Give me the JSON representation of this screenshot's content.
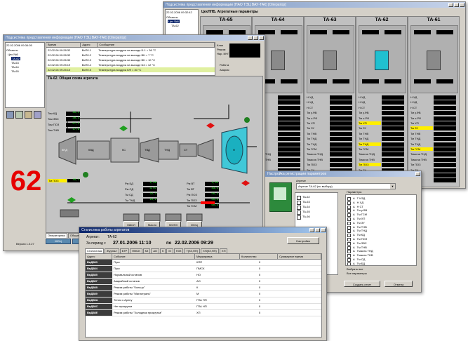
{
  "win_units": {
    "title": "Подсистема представления информации (ПАО ТЭЦ ВАУ-ТАК) [Оператор]",
    "datetime": "22.02.2006 09:32:42",
    "heading": "ЦехЛПБ. Агрегатные параметры",
    "tree_header": "Объекты",
    "tree_items": [
      "Цех №5",
      "ТА-62"
    ],
    "units": [
      "ТА-65",
      "ТА-64",
      "ТА-63",
      "ТА-62",
      "ТА-61"
    ],
    "param_labels": [
      "Н ХД",
      "Н ХД",
      "Н СТ",
      "Тм у.ФВ",
      "Тм о.РФ",
      "Тм ХП",
      "Тм ЗУ",
      "Тм ТНВ",
      "Тм ТНД",
      "Тм ТНД",
      "Тм ГСМ",
      "Тмасла ТНД",
      "Тмасла ТНВ",
      "Тм ПОЗ",
      "Тм ЗУ",
      "Тм КД",
      "Тм ГСМ"
    ]
  },
  "win_scheme": {
    "title": "Подсистема представления информации (ПАО ТЭЦ ВАУ-ТАК) [Оператор]",
    "datetime": "22.02.2006 09:34:05",
    "tree_header": "Объекты",
    "tree_items": [
      "Цех №5",
      "ТА-62",
      "ТА-63",
      "ТА-64",
      "ТА-65"
    ],
    "event_cols": [
      "Время",
      "Адрес",
      "Сообщение"
    ],
    "events": [
      {
        "time": "22.02.06 09:28:32",
        "addr": "ВсП0.1",
        "msg": "Температура воздуха на выходе Б-1 = 36 °С"
      },
      {
        "time": "22.02.06 09:28:32",
        "addr": "ВсП0.2",
        "msg": "Температура воздуха на выходе ВК = 7 °С"
      },
      {
        "time": "22.02.06 09:26:30",
        "addr": "ВсП0.3",
        "msg": "Температура воздуха на выходе ВК = 10 °С"
      },
      {
        "time": "22.02.06 09:25:19",
        "addr": "ВсП0.4",
        "msg": "Температура воздуха на выходе Б4 = 12 °С"
      },
      {
        "time": "22.02.06 09:25:10",
        "addr": "ВсП0.5",
        "msg": "Температура воздуха БФ = 30 °С"
      }
    ],
    "side_labels": [
      "Клап",
      "Режим",
      "Нар. ИНГ",
      "Работа",
      "Авария"
    ],
    "scheme_title": "ТА-62. Общая схема агрегата",
    "big_number": "62",
    "left_params": [
      {
        "name": "Ткм КД",
        "val": "45,4"
      },
      {
        "name": "Ткм ЗВС",
        "val": "30,3"
      },
      {
        "name": "Ткм ПОЗ",
        "val": "57,3"
      },
      {
        "name": "Ткм ТНВ",
        "val": "17,9"
      },
      {
        "name": "Тм ПОЗ",
        "val": "49,1"
      }
    ],
    "stage_labels": [
      "КНД",
      "КВД",
      "КС",
      "ТВД",
      "ТНД",
      "СТ",
      "Н"
    ],
    "mid_params": [
      {
        "name": "Рм БД",
        "val": "2,88"
      },
      {
        "name": "Рм СД",
        "val": "3,07"
      },
      {
        "name": "Тм СД",
        "val": "32,3"
      },
      {
        "name": "Тм ТНД",
        "val": "10,2"
      }
    ],
    "right_params": [
      {
        "name": "Рм ВТ",
        "val": "1,83"
      },
      {
        "name": "Тм ВТ",
        "val": "43,1"
      },
      {
        "name": "Рм ПОЗ",
        "val": "56,4"
      },
      {
        "name": "Тм ПОЗ",
        "val": "55,4"
      },
      {
        "name": "Тм ГСМ",
        "val": "60,2"
      }
    ],
    "bottom_btns": [
      "МАСЛ",
      "Масло",
      "МОНЗ",
      "МОЦ"
    ],
    "footer": "Версия 1.0.27",
    "bottom_tabs": [
      "Операторная",
      "Общие",
      "Двигатель",
      "Дополнительные",
      "Контроль",
      "Сигналы",
      "Маслосистема"
    ],
    "menu_buttons": [
      "МОЦ",
      "МСД",
      "МОЛ",
      "МОНЗ",
      "ДВН",
      "ГЗУ",
      "МОЦ",
      "МСД"
    ]
  },
  "win_params": {
    "title": "Настройка регистрации параметров",
    "group_label": "Агрегат",
    "combo_value": "Агрегат ТА-62 (по выбору)",
    "list_header": "Параметры",
    "units": [
      "ТА-62",
      "ТА-63",
      "ТА-64",
      "ТА-65",
      "ТА-66"
    ],
    "params": [
      {
        "flag": "А",
        "name": "Т ИЗД",
        "checked": false
      },
      {
        "flag": "А",
        "name": "Н ХД",
        "checked": false
      },
      {
        "flag": "А",
        "name": "Н СТ",
        "checked": false
      },
      {
        "flag": "А",
        "name": "Тм у.ФВ",
        "checked": false
      },
      {
        "flag": "А",
        "name": "Тм ГСМ",
        "checked": false
      },
      {
        "flag": "А",
        "name": "Тм ХП",
        "checked": true
      },
      {
        "flag": "А",
        "name": "Тм ЗУ",
        "checked": false
      },
      {
        "flag": "А",
        "name": "Тм ТНВ",
        "checked": false
      },
      {
        "flag": "А",
        "name": "Тм ТНД",
        "checked": false
      },
      {
        "flag": "А",
        "name": "Тм КД",
        "checked": false
      },
      {
        "flag": "А",
        "name": "Тм ПОЗ",
        "checked": false
      },
      {
        "flag": "А",
        "name": "Тм ЗВС",
        "checked": false
      },
      {
        "flag": "А",
        "name": "Тм ТНВ",
        "checked": false
      },
      {
        "flag": "А",
        "name": "Тмасла ТНД",
        "checked": false
      },
      {
        "flag": "А",
        "name": "Тмасла ТНВ",
        "checked": false
      },
      {
        "flag": "А",
        "name": "Тм СД",
        "checked": false
      },
      {
        "flag": "А",
        "name": "Тм БД",
        "checked": false
      }
    ],
    "checkbox1": "Выбрать все",
    "checkbox2": "Все параметры",
    "ok_btn": "Создать отчет",
    "cancel_btn": "Отмена"
  },
  "win_stats": {
    "title": "Статистика работы агрегатов",
    "unit_label": "Агрегат:",
    "unit_value": "ТА-62",
    "period_label": "За период с",
    "period_from": "27.01.2006 11:10",
    "period_to_label": "по",
    "period_to": "22.02.2006 09:29",
    "settings_btn": "Настройки",
    "tabs": [
      "Статистика",
      "Журнал",
      "БТР",
      "ПМСК",
      "КЗ",
      "АО",
      "К",
      "М",
      "ПЗЗ",
      "Т(КЗ,ПП)",
      "ХП(КЗ,НП)",
      "ХП"
    ],
    "columns": [
      "Адрес",
      "Событие",
      "Маркировка",
      "Количество",
      "Суммарное время"
    ],
    "rows": [
      {
        "addr": "ВвД583",
        "event": "Пуск",
        "mark": "КПП",
        "count": "0",
        "time": ""
      },
      {
        "addr": "ВвД584",
        "event": "Пуск",
        "mark": "ПМСК",
        "count": "0",
        "time": ""
      },
      {
        "addr": "ВвД585",
        "event": "Нормальный останов",
        "mark": "НО",
        "count": "0",
        "time": ""
      },
      {
        "addr": "ВвД587",
        "event": "Аварийный останов",
        "mark": "АО",
        "count": "0",
        "time": ""
      },
      {
        "addr": "ВвД588",
        "event": "Режим работы \"Кольцо\"",
        "mark": "К",
        "count": "0",
        "time": ""
      },
      {
        "addr": "ВвД589",
        "event": "Режим работы \"Магистраль\"",
        "mark": "М",
        "count": "0",
        "time": ""
      },
      {
        "addr": "ВвД58А",
        "event": "Тепло к Арену",
        "mark": "ГПА ПП",
        "count": "0",
        "time": ""
      },
      {
        "addr": "ВвД58С",
        "event": "Нет прокрутки",
        "mark": "ГПА НП",
        "count": "0",
        "time": ""
      },
      {
        "addr": "ВвД58Е",
        "event": "Режим работы \"Холодная прокрутка\"",
        "mark": "ХП",
        "count": "0",
        "time": ""
      }
    ]
  }
}
